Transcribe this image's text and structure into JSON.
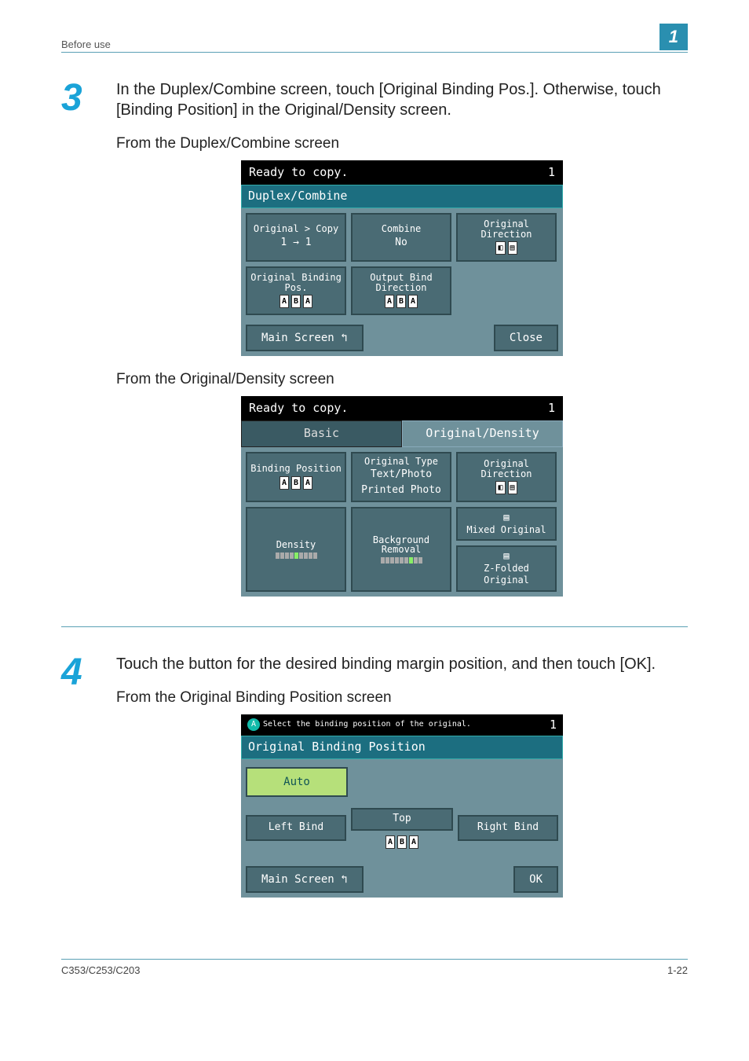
{
  "header": {
    "left": "Before use",
    "right": "1"
  },
  "step3": {
    "num": "3",
    "text1": "In the Duplex/Combine screen, touch [Original Binding Pos.]. Otherwise, touch [Binding Position] in the Original/Density screen.",
    "caption1": "From the Duplex/Combine screen",
    "caption2": "From the Original/Density screen"
  },
  "screen1": {
    "status": "Ready to copy.",
    "count": "1",
    "title": "Duplex/Combine",
    "cells": {
      "orig_copy_l": "Original > Copy",
      "orig_copy_v": "1 → 1",
      "combine_l": "Combine",
      "combine_v": "No",
      "orig_dir_l": "Original Direction",
      "orig_bind_l": "Original Binding Pos.",
      "out_bind_l": "Output Bind Direction"
    },
    "main": "Main Screen",
    "close": "Close"
  },
  "screen2": {
    "status": "Ready to copy.",
    "count": "1",
    "tab1": "Basic",
    "tab2": "Original/Density",
    "cells": {
      "bindpos": "Binding Position",
      "origtype_l": "Original Type",
      "origtype_v1": "Text/Photo",
      "origtype_v2": "Printed Photo",
      "origdir": "Original Direction",
      "density": "Density",
      "bgrem": "Background Removal",
      "mixed": "Mixed Original",
      "zfold": "Z-Folded Original"
    }
  },
  "step4": {
    "num": "4",
    "text1": "Touch the button for the desired binding margin position, and then touch [OK].",
    "caption1": "From the Original Binding Position screen"
  },
  "screen3": {
    "status": "Select the binding position of the original.",
    "count": "1",
    "title": "Original Binding Position",
    "auto": "Auto",
    "top": "Top",
    "left": "Left Bind",
    "right": "Right Bind",
    "main": "Main Screen",
    "ok": "OK"
  },
  "footer": {
    "left": "C353/C253/C203",
    "right": "1-22"
  },
  "ab": {
    "a": "A",
    "b": "B"
  }
}
